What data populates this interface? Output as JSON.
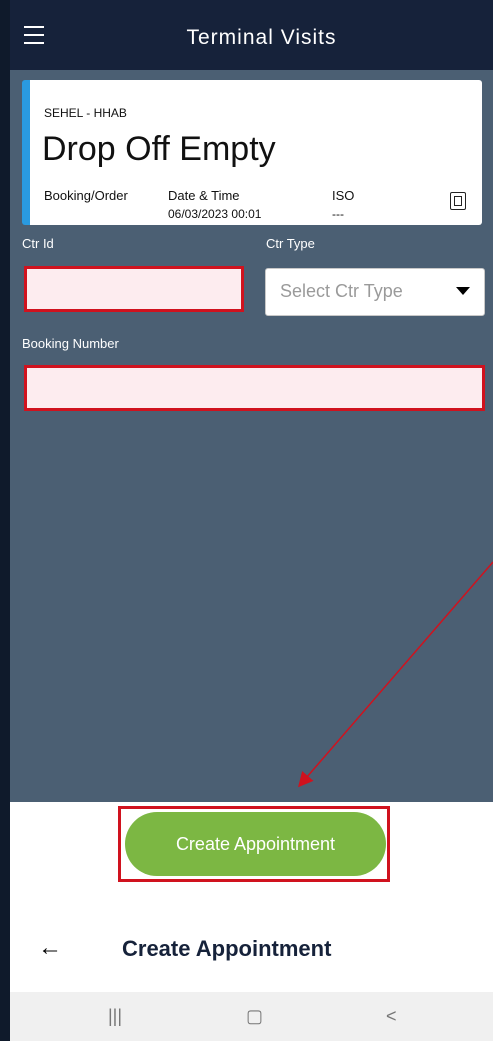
{
  "header": {
    "title": "Terminal Visits"
  },
  "card": {
    "site": "SEHEL - HHAB",
    "title": "Drop Off Empty",
    "booking_label": "Booking/Order",
    "datetime_label": "Date & Time",
    "datetime_value": "06/03/2023 00:01",
    "iso_label": "ISO",
    "iso_value": "---"
  },
  "form": {
    "ctr_id_label": "Ctr Id",
    "ctr_id_value": "",
    "ctr_type_label": "Ctr Type",
    "ctr_type_placeholder": "Select Ctr Type",
    "booking_number_label": "Booking Number",
    "booking_number_value": ""
  },
  "actions": {
    "create_label": "Create Appointment"
  },
  "bottom": {
    "back_glyph": "←",
    "title": "Create Appointment"
  },
  "system_nav": {
    "recent": "|||",
    "home": "▢",
    "back": "<"
  },
  "colors": {
    "topbar": "#16223a",
    "content": "#4b5f73",
    "accent": "#2a9ae0",
    "button": "#7cb743",
    "highlight": "#d0121e"
  }
}
